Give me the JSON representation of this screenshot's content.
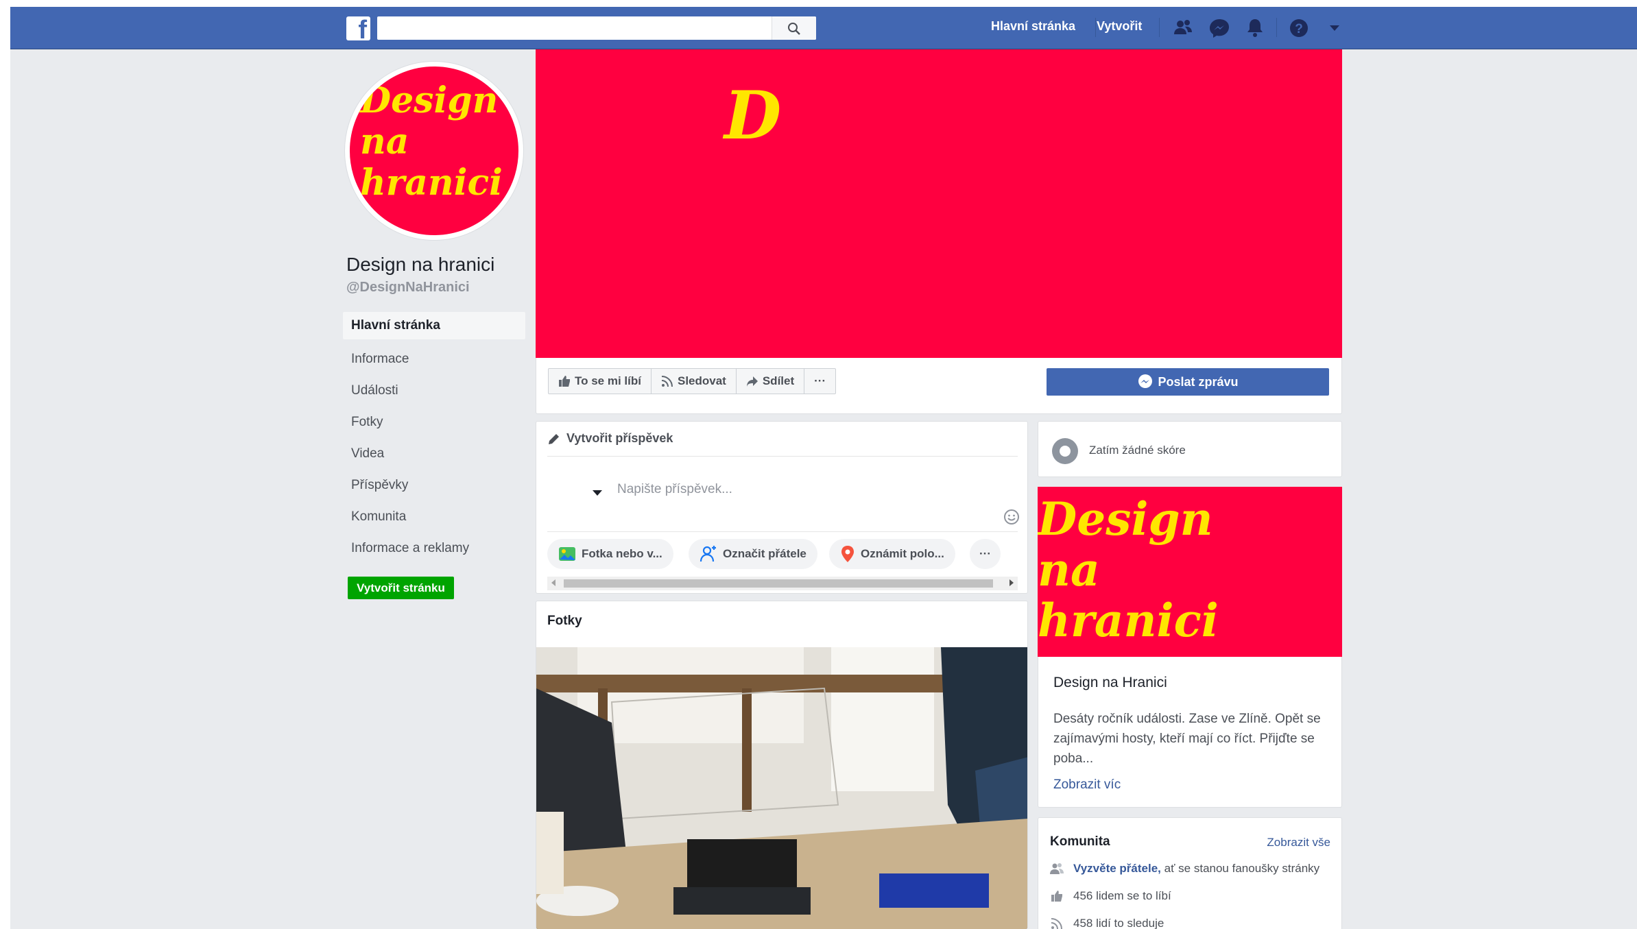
{
  "topbar": {
    "logo_letter": "f",
    "search_placeholder": "",
    "nav_home": "Hlavní stránka",
    "nav_create": "Vytvořit",
    "icons": [
      "friends-icon",
      "messenger-icon",
      "notifications-icon",
      "help-icon",
      "account-menu-icon"
    ]
  },
  "page": {
    "avatar_text": "Design\nna\nhranici",
    "name": "Design na hranici",
    "handle": "@DesignNaHranici"
  },
  "left_nav": {
    "items": [
      "Hlavní stránka",
      "Informace",
      "Události",
      "Fotky",
      "Videa",
      "Příspěvky",
      "Komunita",
      "Informace a reklamy"
    ],
    "create_page": "Vytvořit stránku"
  },
  "cover": {
    "glyph": "D"
  },
  "actions": {
    "like": "To se mi líbí",
    "follow": "Sledovat",
    "share": "Sdílet",
    "more": "···",
    "send_message": "Poslat zprávu"
  },
  "composer": {
    "tab": "Vytvořit příspěvek",
    "placeholder": "Napište příspěvek...",
    "chips": [
      "Fotka nebo v...",
      "Označit přátele",
      "Oznámit polo...",
      "···"
    ]
  },
  "photos": {
    "title": "Fotky"
  },
  "score": {
    "text": "Zatím žádné skóre"
  },
  "about": {
    "image_text": "Design\nna\nhranici",
    "title": "Design na Hranici",
    "description": "Desáty ročník události. Zase ve Zlíně. Opět se zajímavými hosty, kteří mají co říct. Přijďte se poba...",
    "more": "Zobrazit víc"
  },
  "community": {
    "title": "Komunita",
    "see_all": "Zobrazit vše",
    "invite_link": "Vyzvěte přátele,",
    "invite_rest": " ať se stanou fanoušky stránky",
    "likes": "456 lidem se to líbí",
    "follows": "458 lidí to sleduje"
  },
  "colors": {
    "brand": "#4267b2",
    "page_accent": "#ff0040",
    "logo_yellow": "#ffe600",
    "create_green": "#00a400"
  }
}
